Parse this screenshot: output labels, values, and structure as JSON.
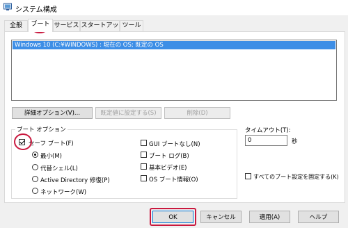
{
  "window": {
    "title": "システム構成"
  },
  "tabs": [
    {
      "label": "全般"
    },
    {
      "label": "ブート"
    },
    {
      "label": "サービス"
    },
    {
      "label": "スタートアップ"
    },
    {
      "label": "ツール"
    }
  ],
  "os_list": [
    {
      "label": "Windows 10 (C:¥WINDOWS) : 現在の OS; 既定の OS"
    }
  ],
  "list_buttons": {
    "advanced": "詳細オプション(V)...",
    "set_default": "既定値に設定する(S)",
    "delete": "削除(D)"
  },
  "boot_options": {
    "group_label": "ブート オプション",
    "safe_boot": "セーフ ブート(F)",
    "minimal": "最小(M)",
    "alternate_shell": "代替シェル(L)",
    "active_directory": "Active Directory 修復(P)",
    "network": "ネットワーク(W)",
    "no_gui": "GUI ブートなし(N)",
    "boot_log": "ブート ログ(B)",
    "base_video": "基本ビデオ(E)",
    "os_boot_info": "OS ブート情報(O)"
  },
  "timeout": {
    "label": "タイムアウト(T):",
    "value": "0",
    "unit": "秒"
  },
  "make_permanent": "すべてのブート設定を固定する(K)",
  "footer_buttons": {
    "ok": "OK",
    "cancel": "キャンセル",
    "apply": "適用(A)",
    "help": "ヘルプ"
  }
}
